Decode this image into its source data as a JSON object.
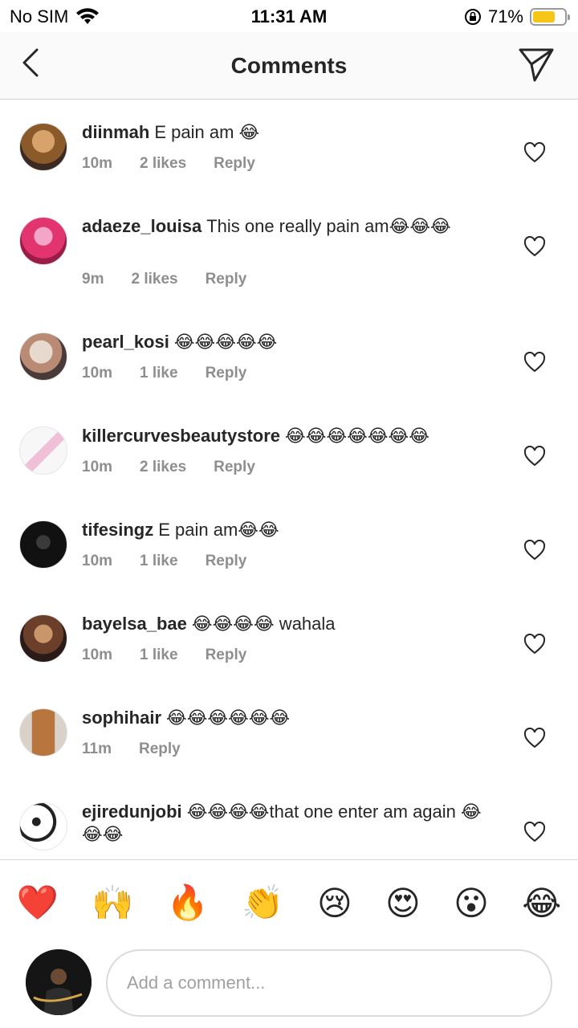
{
  "status": {
    "carrier": "No SIM",
    "time": "11:31 AM",
    "battery_percent": "71%",
    "battery_level": 0.71
  },
  "header": {
    "title": "Comments"
  },
  "comments": [
    {
      "user": "diinmah",
      "text": "E pain am 😂",
      "time": "10m",
      "likes": "2 likes",
      "reply": "Reply"
    },
    {
      "user": "adaeze_louisa",
      "text": "This one really pain am😂😂😂",
      "time": "9m",
      "likes": "2 likes",
      "reply": "Reply"
    },
    {
      "user": "pearl_kosi",
      "text": "😂😂😂😂😂",
      "time": "10m",
      "likes": "1 like",
      "reply": "Reply"
    },
    {
      "user": "killercurvesbeautystore",
      "text": "😂😂😂😂😂😂😂",
      "time": "10m",
      "likes": "2 likes",
      "reply": "Reply"
    },
    {
      "user": "tifesingz",
      "text": "E pain am😂😂",
      "time": "10m",
      "likes": "1 like",
      "reply": "Reply"
    },
    {
      "user": "bayelsa_bae",
      "text": "😂😂😂😂 wahala",
      "time": "10m",
      "likes": "1 like",
      "reply": "Reply"
    },
    {
      "user": "sophihair",
      "text": "😂😂😂😂😂😂",
      "time": "11m",
      "likes": "",
      "reply": "Reply"
    },
    {
      "user": "ejiredunjobi",
      "text": "😂😂😂😂that one enter am again 😂😂😂",
      "time": "",
      "likes": "",
      "reply": ""
    }
  ],
  "reactions": [
    "❤️",
    "🙌",
    "🔥",
    "👏",
    "😢",
    "😍",
    "😮",
    "😂"
  ],
  "composer": {
    "placeholder": "Add a comment..."
  },
  "colors": {
    "meta_gray": "#8e8e8e",
    "text": "#262626",
    "battery": "#f5c518"
  }
}
